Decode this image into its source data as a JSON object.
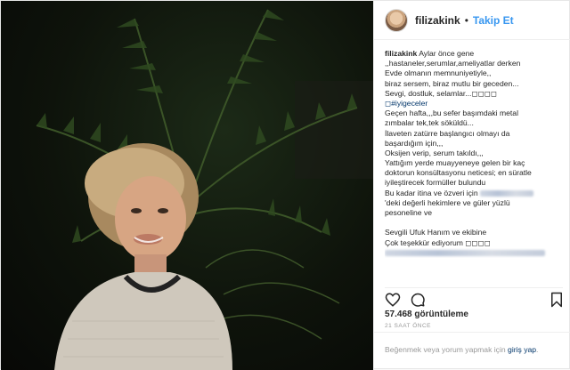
{
  "header": {
    "username": "filizakink",
    "separator": "•",
    "follow_label": "Takip Et"
  },
  "caption": {
    "username": "filizakink",
    "first_line": "Aylar önce gene",
    "lines": [
      ",,hastaneler,serumlar,ameliyatlar derken",
      "Evde olmanın memnuniyetiyle,,",
      "biraz sersem, biraz mutlu bir geceden...",
      "Sevgi, dostluk, selamlar...◻◻◻◻",
      "Geçen hafta,,,bu sefer başımdaki metal",
      "zımbalar tek,tek söküldü...",
      "İlaveten zatürre başlangıcı olmayı da",
      "başardığım için,,,",
      "Oksijen verip, serum takıldı,,,",
      "Yattığım yerde muayyeneye gelen bir kaç",
      "doktorun konsültasyonu neticesi; en süratle",
      "iyileştirecek formüller bulundu",
      "Bu kadar itina ve özveri için",
      "'deki değerli hekimlere ve güler yüzlü",
      "pesoneline ve",
      "",
      "Sevgili Ufuk Hanım ve ekibine",
      "Çok teşekkür ediyorum ◻◻◻◻"
    ],
    "hashtag": "◻#iyigeceler"
  },
  "actions": {
    "like_icon": "heart-icon",
    "comment_icon": "comment-icon",
    "share_icon": "share-icon",
    "save_icon": "bookmark-icon"
  },
  "views": "57.468 görüntüleme",
  "timestamp": "21 SAAT ÖNCE",
  "footer": {
    "prompt": "Beğenmek veya yorum yapmak için",
    "login_label": "giriş yap",
    "suffix": "."
  }
}
